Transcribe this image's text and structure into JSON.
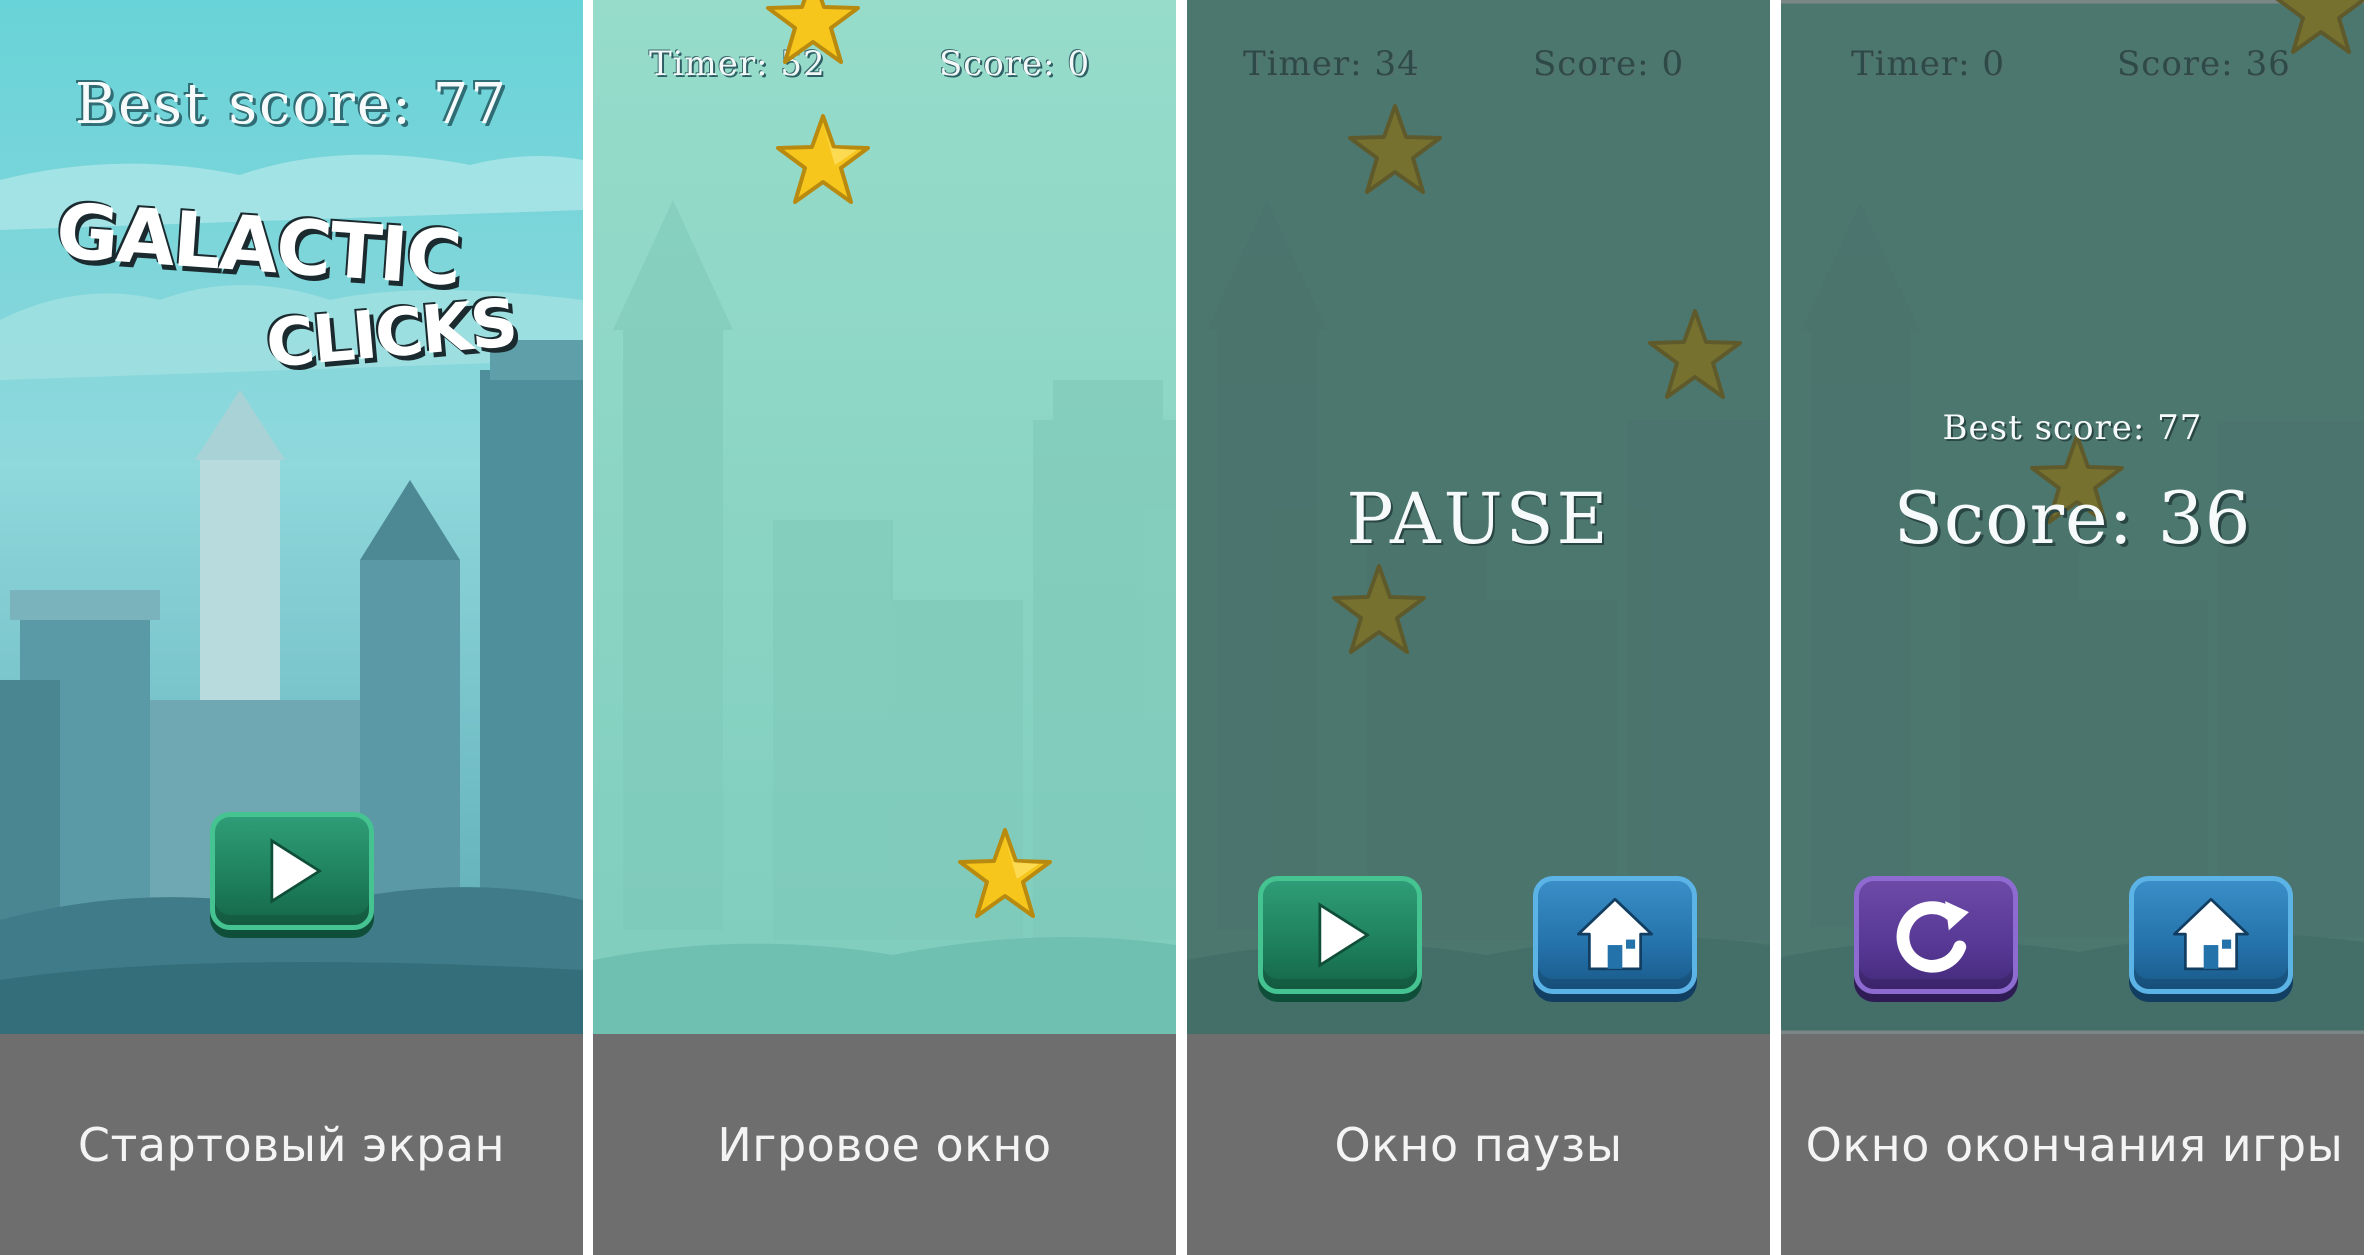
{
  "panels": {
    "start": {
      "best_score": "Best score: 77",
      "logo_line1": "GALACTIC",
      "logo_line2": "CLICKS",
      "caption": "Стартовый экран"
    },
    "game": {
      "timer": "Timer: 52",
      "score": "Score: 0",
      "caption": "Игровое окно"
    },
    "pause": {
      "timer": "Timer: 34",
      "score": "Score: 0",
      "title": "PAUSE",
      "caption": "Окно паузы"
    },
    "gameover": {
      "timer": "Timer: 0",
      "score": "Score: 36",
      "best_score": "Best score: 77",
      "final_score": "Score: 36",
      "caption": "Окно окончания игры"
    }
  },
  "colors": {
    "sky_light": "#6fd4d6",
    "game_bg": "#86d6c3",
    "overlay": "#3f6a63",
    "caption_bg": "#6e6e6e",
    "star": "#f6c61c",
    "button_green": "#1f8560",
    "button_blue": "#2472aa",
    "button_purple": "#573895"
  },
  "icons": [
    "play-icon",
    "home-icon",
    "restart-icon",
    "star-icon"
  ]
}
